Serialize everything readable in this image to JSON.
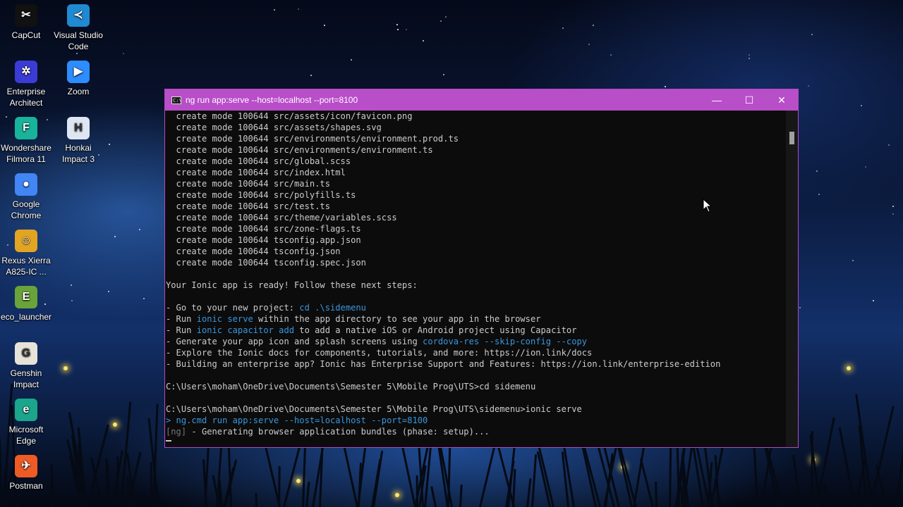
{
  "desktop_icons": [
    {
      "label": "CapCut",
      "icon": "capcut-icon",
      "color": "#111111",
      "glyph": "✂"
    },
    {
      "label": "Visual Studio Code",
      "icon": "vscode-icon",
      "color": "#1f8ad2",
      "glyph": "≺"
    },
    {
      "label": "Enterprise Architect",
      "icon": "enterprise-architect-icon",
      "color": "#3b3bd6",
      "glyph": "✲"
    },
    {
      "label": "Zoom",
      "icon": "zoom-icon",
      "color": "#2d8cff",
      "glyph": "▶"
    },
    {
      "label": "Wondershare Filmora 11",
      "icon": "filmora-icon",
      "color": "#18b39a",
      "glyph": "F"
    },
    {
      "label": "Honkai Impact 3",
      "icon": "honkai-icon",
      "color": "#dfe6f3",
      "glyph": "H"
    },
    {
      "label": "Google Chrome",
      "icon": "chrome-icon",
      "color": "#4285f4",
      "glyph": "●"
    },
    {
      "label": "Rexus Xierra A825-IC ...",
      "icon": "rexus-icon",
      "color": "#e2a522",
      "glyph": "☺"
    },
    {
      "label": "eco_launcher",
      "icon": "eco-launcher-icon",
      "color": "#6aa33a",
      "glyph": "E"
    },
    {
      "label": "Genshin Impact",
      "icon": "genshin-icon",
      "color": "#e8e3d8",
      "glyph": "G"
    },
    {
      "label": "Microsoft Edge",
      "icon": "edge-icon",
      "color": "#1aa58c",
      "glyph": "e"
    },
    {
      "label": "Postman",
      "icon": "postman-icon",
      "color": "#ef5b25",
      "glyph": "✈"
    }
  ],
  "window": {
    "title": "ng run app:serve --host=localhost --port=8100",
    "accent": "#b94ec9",
    "buttons": {
      "minimize": "—",
      "maximize": "☐",
      "close": "✕"
    }
  },
  "console_lines": [
    [
      {
        "t": "  create mode 100644 src/assets/icon/favicon.png"
      }
    ],
    [
      {
        "t": "  create mode 100644 src/assets/shapes.svg"
      }
    ],
    [
      {
        "t": "  create mode 100644 src/environments/environment.prod.ts"
      }
    ],
    [
      {
        "t": "  create mode 100644 src/environments/environment.ts"
      }
    ],
    [
      {
        "t": "  create mode 100644 src/global.scss"
      }
    ],
    [
      {
        "t": "  create mode 100644 src/index.html"
      }
    ],
    [
      {
        "t": "  create mode 100644 src/main.ts"
      }
    ],
    [
      {
        "t": "  create mode 100644 src/polyfills.ts"
      }
    ],
    [
      {
        "t": "  create mode 100644 src/test.ts"
      }
    ],
    [
      {
        "t": "  create mode 100644 src/theme/variables.scss"
      }
    ],
    [
      {
        "t": "  create mode 100644 src/zone-flags.ts"
      }
    ],
    [
      {
        "t": "  create mode 100644 tsconfig.app.json"
      }
    ],
    [
      {
        "t": "  create mode 100644 tsconfig.json"
      }
    ],
    [
      {
        "t": "  create mode 100644 tsconfig.spec.json"
      }
    ],
    [
      {
        "t": ""
      }
    ],
    [
      {
        "t": "Your Ionic app is ready! Follow these next steps:"
      }
    ],
    [
      {
        "t": ""
      }
    ],
    [
      {
        "t": "- Go to your new project: "
      },
      {
        "t": "cd .\\sidemenu",
        "c": "hl"
      }
    ],
    [
      {
        "t": "- Run "
      },
      {
        "t": "ionic serve",
        "c": "hl"
      },
      {
        "t": " within the app directory to see your app in the browser"
      }
    ],
    [
      {
        "t": "- Run "
      },
      {
        "t": "ionic capacitor add",
        "c": "hl"
      },
      {
        "t": " to add a native iOS or Android project using Capacitor"
      }
    ],
    [
      {
        "t": "- Generate your app icon and splash screens using "
      },
      {
        "t": "cordova-res --skip-config --copy",
        "c": "hl"
      }
    ],
    [
      {
        "t": "- Explore the Ionic docs for components, tutorials, and more: https://ion.link/docs"
      }
    ],
    [
      {
        "t": "- Building an enterprise app? Ionic has Enterprise Support and Features: https://ion.link/enterprise-edition"
      }
    ],
    [
      {
        "t": ""
      }
    ],
    [
      {
        "t": "C:\\Users\\moham\\OneDrive\\Documents\\Semester 5\\Mobile Prog\\UTS>cd sidemenu"
      }
    ],
    [
      {
        "t": ""
      }
    ],
    [
      {
        "t": "C:\\Users\\moham\\OneDrive\\Documents\\Semester 5\\Mobile Prog\\UTS\\sidemenu>ionic serve"
      }
    ],
    [
      {
        "t": "> ng.cmd run app:serve --host=localhost --port=8100",
        "c": "hl"
      }
    ],
    [
      {
        "t": "[ng]",
        "c": "grey"
      },
      {
        "t": " - Generating browser application bundles (phase: setup)..."
      }
    ]
  ]
}
